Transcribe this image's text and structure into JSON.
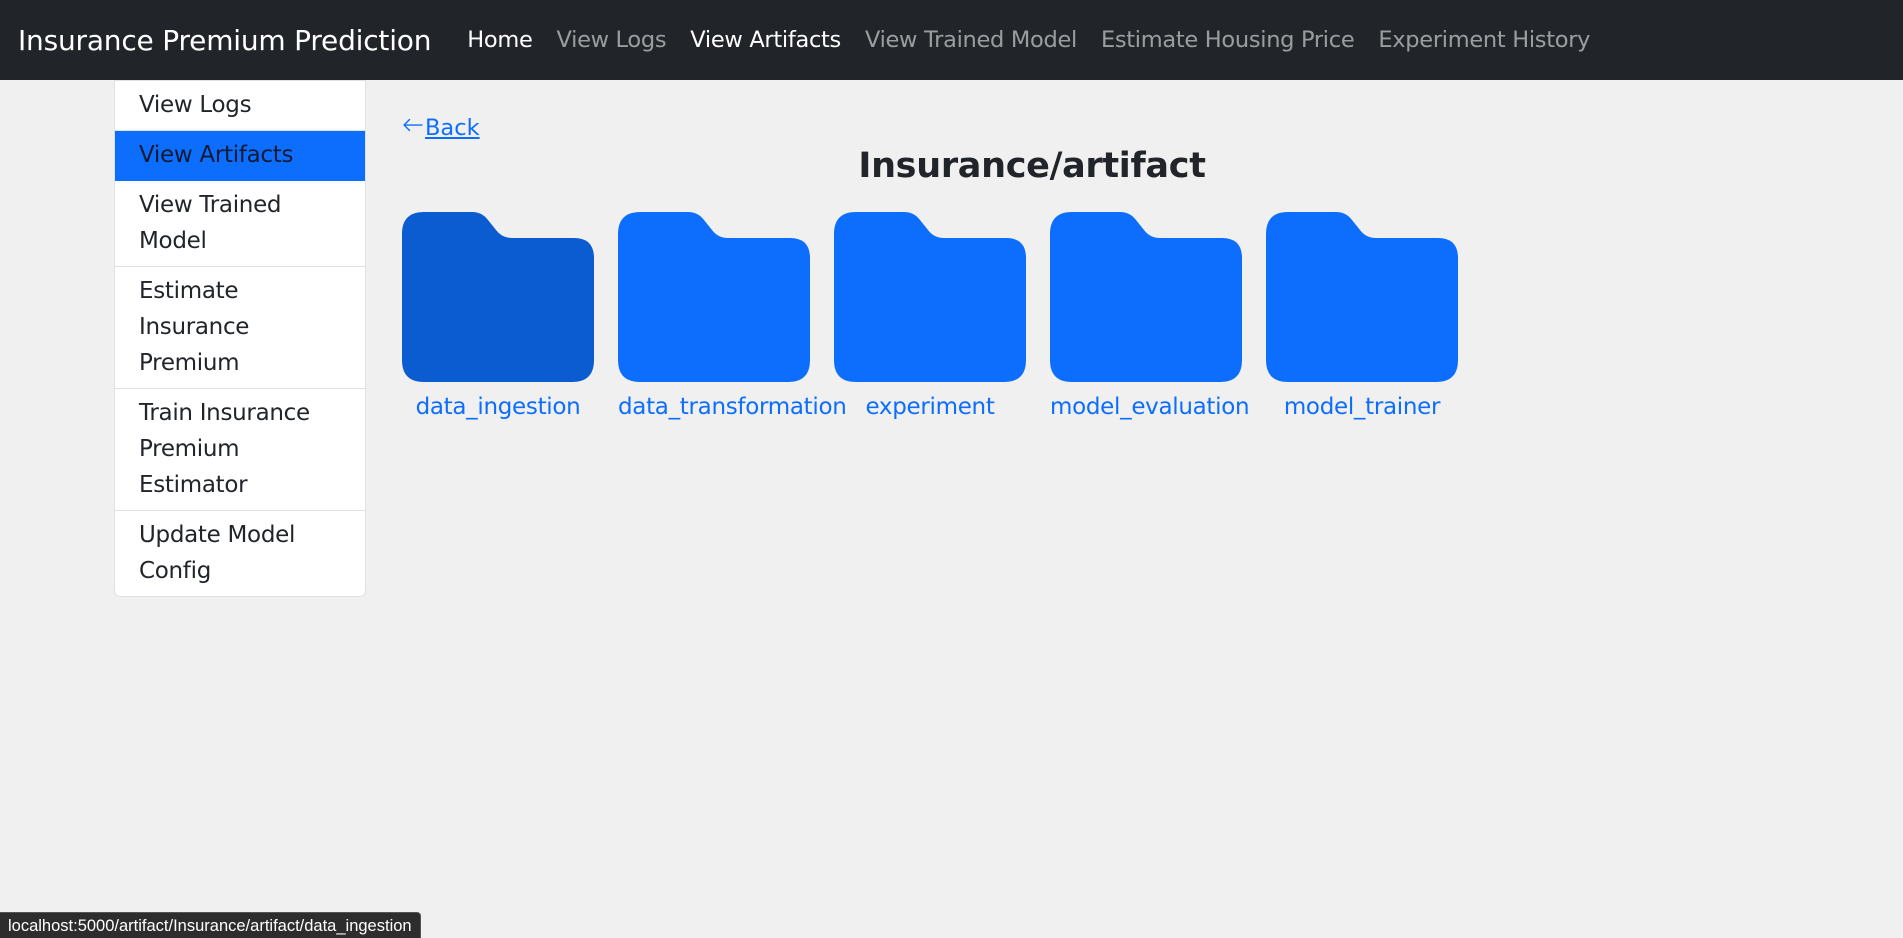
{
  "navbar": {
    "brand": "Insurance Premium Prediction",
    "links": [
      {
        "label": "Home",
        "active": true
      },
      {
        "label": "View Logs",
        "active": false
      },
      {
        "label": "View Artifacts",
        "active": true
      },
      {
        "label": "View Trained Model",
        "active": false
      },
      {
        "label": "Estimate Housing Price",
        "active": false
      },
      {
        "label": "Experiment History",
        "active": false
      }
    ]
  },
  "sidebar": {
    "items": [
      {
        "label": "View Logs",
        "active": false
      },
      {
        "label": "View Artifacts",
        "active": true
      },
      {
        "label": "View Trained Model",
        "active": false
      },
      {
        "label": "Estimate Insurance Premium",
        "active": false
      },
      {
        "label": "Train Insurance Premium Estimator",
        "active": false
      },
      {
        "label": "Update Model Config",
        "active": false
      }
    ]
  },
  "main": {
    "back_label": "Back",
    "back_icon": "arrow-left-icon",
    "title": "Insurance/artifact",
    "folders": [
      {
        "name": "data_ingestion",
        "hovered": true
      },
      {
        "name": "data_transformation",
        "hovered": false
      },
      {
        "name": "experiment",
        "hovered": false
      },
      {
        "name": "model_evaluation",
        "hovered": false
      },
      {
        "name": "model_trainer",
        "hovered": false
      }
    ]
  },
  "statusbar": {
    "url": "localhost:5000/artifact/Insurance/artifact/data_ingestion"
  },
  "colors": {
    "navbar_bg": "#212529",
    "accent": "#0d6efd",
    "folder_hover": "#0b5bd1",
    "page_bg": "#f0f0f0"
  }
}
